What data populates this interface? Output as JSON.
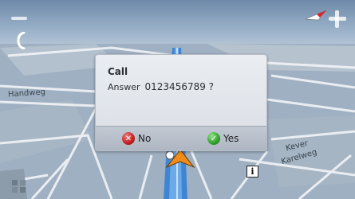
{
  "toolbar": {
    "zoom_out_icon": "minus-icon",
    "zoom_in_icon": "plus-icon",
    "compass_icon": "compass-icon",
    "phone_icon": "phone-icon"
  },
  "map": {
    "streets": [
      "Handweg",
      "Kever",
      "Karelweg"
    ]
  },
  "call_dialog": {
    "title": "Call",
    "label": "Answer",
    "number": "0123456789 ?",
    "no_label": "No",
    "yes_label": "Yes"
  },
  "colors": {
    "route": "#2d7fd6",
    "arrow": "#f08c1a",
    "no": "#c11f1f",
    "yes": "#2fa12a"
  }
}
